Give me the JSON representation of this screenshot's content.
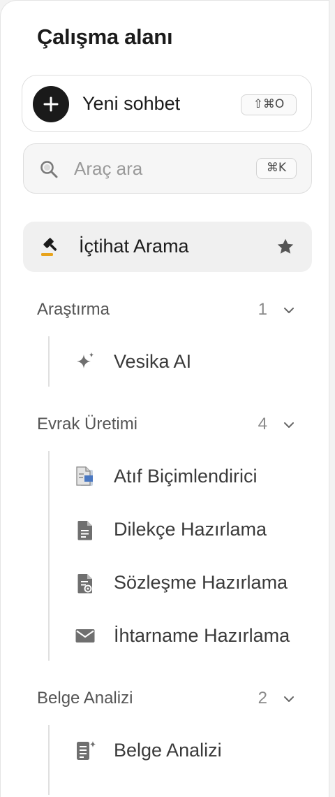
{
  "workspace": {
    "title": "Çalışma alanı"
  },
  "new_chat": {
    "label": "Yeni sohbet",
    "shortcut": "⇧⌘O",
    "icon": "plus-icon"
  },
  "search": {
    "placeholder": "Araç ara",
    "value": "",
    "shortcut": "⌘K",
    "icon": "search-icon"
  },
  "pinned": {
    "label": "İçtihat Arama",
    "icon": "gavel-icon",
    "favorite_icon": "star-icon"
  },
  "sections": [
    {
      "title": "Araştırma",
      "count": "1",
      "items": [
        {
          "label": "Vesika AI",
          "icon": "sparkle-icon"
        }
      ]
    },
    {
      "title": "Evrak Üretimi",
      "count": "4",
      "items": [
        {
          "label": "Atıf Biçimlendirici",
          "icon": "citation-document-icon"
        },
        {
          "label": "Dilekçe Hazırlama",
          "icon": "document-icon"
        },
        {
          "label": "Sözleşme Hazırlama",
          "icon": "contract-document-icon"
        },
        {
          "label": "İhtarname Hazırlama",
          "icon": "envelope-icon"
        }
      ]
    },
    {
      "title": "Belge Analizi",
      "count": "2",
      "items": [
        {
          "label": "Belge Analizi",
          "icon": "document-sparkle-icon"
        }
      ]
    }
  ],
  "colors": {
    "accent_orange": "#e8a31b",
    "icon_dark": "#1a1a1a",
    "icon_gray": "#6f6f6f",
    "text_primary": "#1b1b1b",
    "text_secondary": "#555555"
  }
}
